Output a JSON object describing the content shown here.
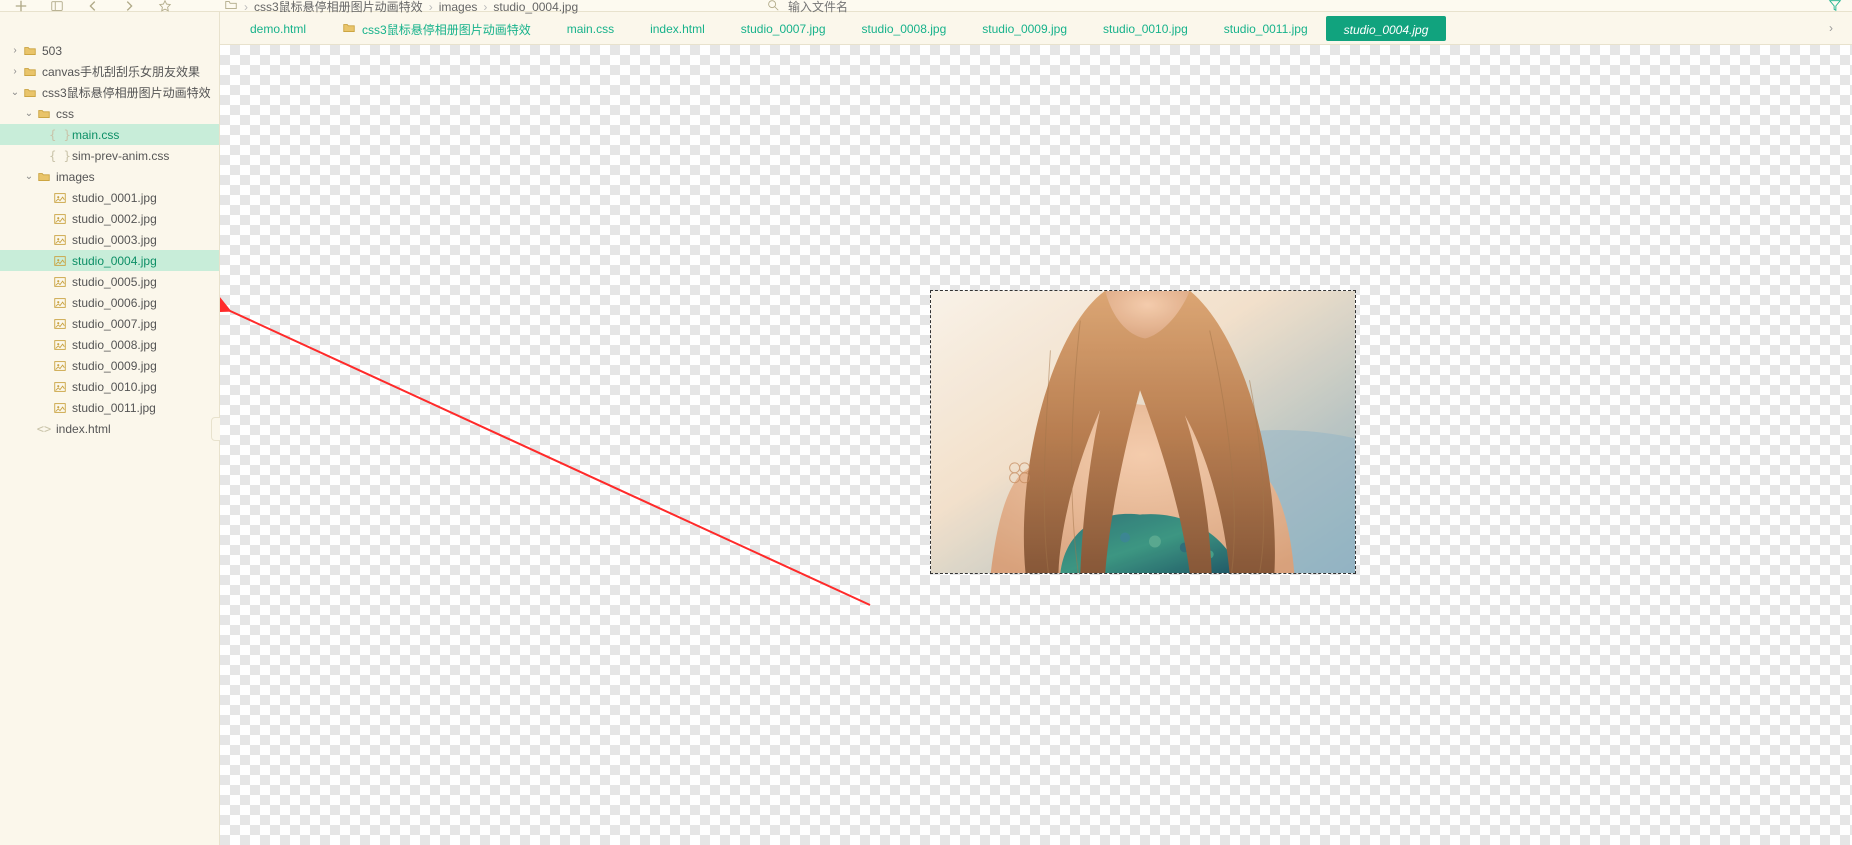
{
  "toolbar": {},
  "breadcrumbs": [
    {
      "label": "css3鼠标悬停相册图片动画特效",
      "type": "folder"
    },
    {
      "label": "images",
      "type": "folder"
    },
    {
      "label": "studio_0004.jpg",
      "type": "file"
    }
  ],
  "search": {
    "placeholder": "输入文件名"
  },
  "sidebar": {
    "items": [
      {
        "depth": 0,
        "twisty": ">",
        "ico": "folder",
        "label": "503"
      },
      {
        "depth": 0,
        "twisty": ">",
        "ico": "folder",
        "label": "canvas手机刮刮乐女朋友效果"
      },
      {
        "depth": 0,
        "twisty": "v",
        "ico": "folder",
        "label": "css3鼠标悬停相册图片动画特效"
      },
      {
        "depth": 1,
        "twisty": "v",
        "ico": "folder",
        "label": "css"
      },
      {
        "depth": 2,
        "twisty": "",
        "ico": "css",
        "label": "main.css",
        "sel": true
      },
      {
        "depth": 2,
        "twisty": "",
        "ico": "css",
        "label": "sim-prev-anim.css"
      },
      {
        "depth": 1,
        "twisty": "v",
        "ico": "folder",
        "label": "images"
      },
      {
        "depth": 2,
        "twisty": "",
        "ico": "img",
        "label": "studio_0001.jpg"
      },
      {
        "depth": 2,
        "twisty": "",
        "ico": "img",
        "label": "studio_0002.jpg"
      },
      {
        "depth": 2,
        "twisty": "",
        "ico": "img",
        "label": "studio_0003.jpg"
      },
      {
        "depth": 2,
        "twisty": "",
        "ico": "img",
        "label": "studio_0004.jpg",
        "sel": true
      },
      {
        "depth": 2,
        "twisty": "",
        "ico": "img",
        "label": "studio_0005.jpg"
      },
      {
        "depth": 2,
        "twisty": "",
        "ico": "img",
        "label": "studio_0006.jpg"
      },
      {
        "depth": 2,
        "twisty": "",
        "ico": "img",
        "label": "studio_0007.jpg"
      },
      {
        "depth": 2,
        "twisty": "",
        "ico": "img",
        "label": "studio_0008.jpg"
      },
      {
        "depth": 2,
        "twisty": "",
        "ico": "img",
        "label": "studio_0009.jpg"
      },
      {
        "depth": 2,
        "twisty": "",
        "ico": "img",
        "label": "studio_0010.jpg"
      },
      {
        "depth": 2,
        "twisty": "",
        "ico": "img",
        "label": "studio_0011.jpg"
      },
      {
        "depth": 1,
        "twisty": "",
        "ico": "html",
        "label": "index.html"
      }
    ]
  },
  "tabs": [
    {
      "label": "demo.html"
    },
    {
      "label": "css3鼠标悬停相册图片动画特效",
      "folder": true
    },
    {
      "label": "main.css"
    },
    {
      "label": "index.html"
    },
    {
      "label": "studio_0007.jpg"
    },
    {
      "label": "studio_0008.jpg"
    },
    {
      "label": "studio_0009.jpg"
    },
    {
      "label": "studio_0010.jpg"
    },
    {
      "label": "studio_0011.jpg"
    },
    {
      "label": "studio_0004.jpg",
      "active": true
    }
  ],
  "image": {
    "name": "studio_0004.jpg"
  }
}
